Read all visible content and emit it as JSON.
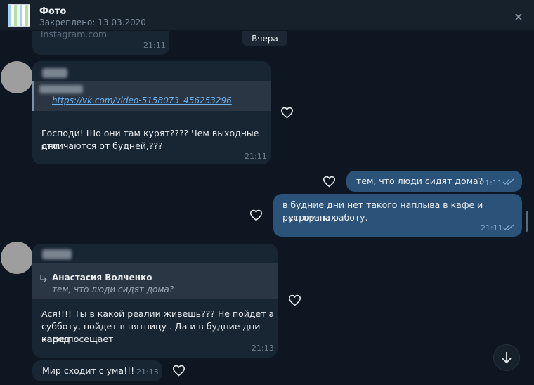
{
  "pinned": {
    "title": "Фото",
    "subtitle": "Закреплено: 13.03.2020"
  },
  "date_divider": "Вчера",
  "messages": [
    {
      "id": "m0",
      "link_domain": "instagram.com",
      "time": "21:11"
    },
    {
      "id": "m1",
      "link_url": "https://vk.com/video-5158073_456253296",
      "text_line1": "Господи! Шо они там курят???? Чем выходные дни",
      "text_line2": "отличаются от будней,???",
      "time": "21:11"
    },
    {
      "id": "m2",
      "text": "тем, что люди сидят дома?",
      "time": "21:11"
    },
    {
      "id": "m3",
      "text_line1": "в будние дни нет такого наплыва в кафе и ресторанах",
      "text_line2": "- утром на работу.",
      "time": "21:11"
    },
    {
      "id": "m4",
      "reply_author": "Анастасия Волченко",
      "reply_text": "тем, что люди сидят дома?",
      "text_line1": "Ася!!!! Ты в какой реалии живешь??? Не пойдет а",
      "text_line2": "субботу, пойдет в пятницу . Да и в будние дни народ",
      "text_line3": "кафе посещает",
      "time": "21:13"
    },
    {
      "id": "m5",
      "text": "Мир сходит с ума!!!",
      "time": "21:13"
    }
  ],
  "icons": {
    "close": "close-icon",
    "like": "heart-outline-icon",
    "read": "double-check-icon",
    "reply": "reply-arrow-icon",
    "scroll_down": "arrow-down-icon"
  },
  "colors": {
    "chat_background": "#0e1621",
    "incoming_bubble": "#182533",
    "outgoing_bubble": "#2b5278",
    "link": "#6ab3f3"
  }
}
